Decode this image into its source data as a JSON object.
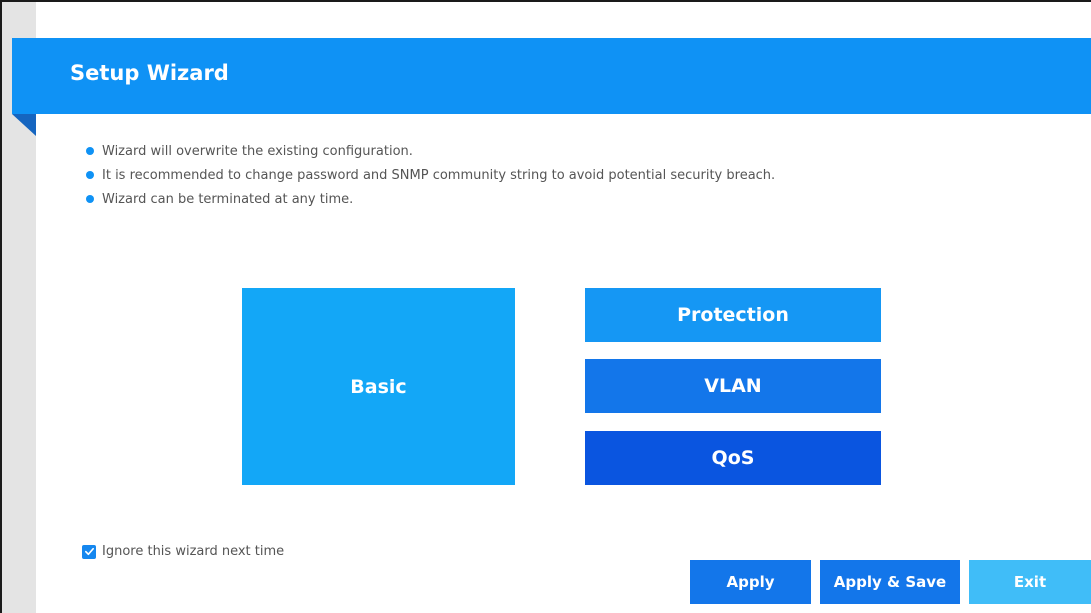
{
  "header": {
    "title": "Setup Wizard"
  },
  "notes": [
    "Wizard will overwrite the existing configuration.",
    "It is recommended to change password and SNMP community string to avoid potential security breach.",
    "Wizard can be terminated at any time."
  ],
  "tiles": {
    "basic": "Basic",
    "protection": "Protection",
    "vlan": "VLAN",
    "qos": "QoS"
  },
  "ignore_checkbox": {
    "label": "Ignore this wizard next time",
    "checked": true
  },
  "buttons": {
    "apply": "Apply",
    "apply_save": "Apply & Save",
    "exit": "Exit"
  },
  "colors": {
    "header": "#0f92f5",
    "basic": "#13a7f7",
    "protection": "#1597f4",
    "vlan": "#1376ea",
    "qos": "#0a55e0",
    "exit": "#40bdf8"
  },
  "icons": {
    "bullet": "dot-icon",
    "checkbox": "check-icon"
  }
}
